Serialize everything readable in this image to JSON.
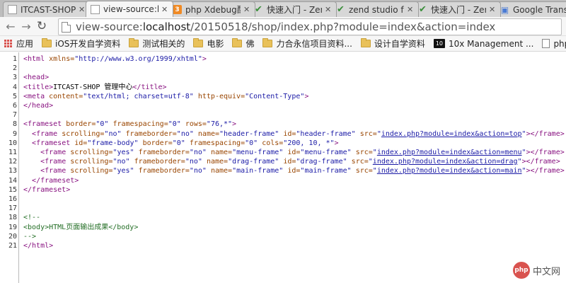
{
  "tabs": [
    {
      "title": "ITCAST-SHOP",
      "icon": "page-icon",
      "active": false
    },
    {
      "title": "view-source:l",
      "icon": "page-icon",
      "active": true
    },
    {
      "title": "php Xdebug配",
      "icon": "php-icon",
      "active": false
    },
    {
      "title": "快速入门 - Zen",
      "icon": "check-icon",
      "active": false
    },
    {
      "title": "zend studio fo",
      "icon": "check-icon",
      "active": false
    },
    {
      "title": "快速入门 - Zen",
      "icon": "check-icon",
      "active": false
    },
    {
      "title": "Google Trans",
      "icon": "google-icon",
      "active": false
    }
  ],
  "toolbar": {
    "url_scheme": "view-source:",
    "url_host": "localhost",
    "url_rest": "/20150518/shop/index.php?module=index&action=index"
  },
  "bookmarks": [
    {
      "label": "应用",
      "icon": "apps-icon"
    },
    {
      "label": "iOS开发自学资料",
      "icon": "folder-icon"
    },
    {
      "label": "测试相关的",
      "icon": "folder-icon"
    },
    {
      "label": "电影",
      "icon": "folder-icon"
    },
    {
      "label": "佛",
      "icon": "folder-icon"
    },
    {
      "label": "力合永信项目资料...",
      "icon": "folder-icon"
    },
    {
      "label": "设计自学资料",
      "icon": "folder-icon"
    },
    {
      "label": "10x Management ...",
      "icon": "tenx-icon"
    },
    {
      "label": "php外包服务商蓝",
      "icon": "page-icon"
    }
  ],
  "source_lines": [
    {
      "n": "1",
      "parts": [
        [
          "tag",
          "<html "
        ],
        [
          "attr",
          "xmlns="
        ],
        [
          "val",
          "\"http://www.w3.org/1999/xhtml\""
        ],
        [
          "tag",
          ">"
        ]
      ]
    },
    {
      "n": "2",
      "parts": []
    },
    {
      "n": "3",
      "parts": [
        [
          "tag",
          "<head>"
        ]
      ]
    },
    {
      "n": "4",
      "parts": [
        [
          "tag",
          "<title>"
        ],
        [
          "txt",
          "ITCAST-SHOP 管理中心"
        ],
        [
          "tag",
          "</title>"
        ]
      ]
    },
    {
      "n": "5",
      "parts": [
        [
          "tag",
          "<meta "
        ],
        [
          "attr",
          "content="
        ],
        [
          "val",
          "\"text/html; charset=utf-8\""
        ],
        [
          "attr",
          " http-equiv="
        ],
        [
          "val",
          "\"Content-Type\""
        ],
        [
          "tag",
          ">"
        ]
      ]
    },
    {
      "n": "6",
      "parts": [
        [
          "tag",
          "</head>"
        ]
      ]
    },
    {
      "n": "7",
      "parts": []
    },
    {
      "n": "8",
      "parts": [
        [
          "tag",
          "<frameset "
        ],
        [
          "attr",
          "border="
        ],
        [
          "val",
          "\"0\""
        ],
        [
          "attr",
          " framespacing="
        ],
        [
          "val",
          "\"0\""
        ],
        [
          "attr",
          " rows="
        ],
        [
          "val",
          "\"76,*\""
        ],
        [
          "tag",
          ">"
        ]
      ]
    },
    {
      "n": "9",
      "parts": [
        [
          "txt",
          "  "
        ],
        [
          "tag",
          "<frame "
        ],
        [
          "attr",
          "scrolling="
        ],
        [
          "val",
          "\"no\""
        ],
        [
          "attr",
          " frameborder="
        ],
        [
          "val",
          "\"no\""
        ],
        [
          "attr",
          " name="
        ],
        [
          "val",
          "\"header-frame\""
        ],
        [
          "attr",
          " id="
        ],
        [
          "val",
          "\"header-frame\""
        ],
        [
          "attr",
          " src="
        ],
        [
          "val",
          "\""
        ],
        [
          "lnk",
          "index.php?module=index&action=top"
        ],
        [
          "val",
          "\""
        ],
        [
          "tag",
          "></frame>"
        ]
      ]
    },
    {
      "n": "10",
      "parts": [
        [
          "txt",
          "  "
        ],
        [
          "tag",
          "<frameset "
        ],
        [
          "attr",
          "id="
        ],
        [
          "val",
          "\"frame-body\""
        ],
        [
          "attr",
          " border="
        ],
        [
          "val",
          "\"0\""
        ],
        [
          "attr",
          " framespacing="
        ],
        [
          "val",
          "\"0\""
        ],
        [
          "attr",
          " cols="
        ],
        [
          "val",
          "\"200, 10, *\""
        ],
        [
          "tag",
          ">"
        ]
      ]
    },
    {
      "n": "11",
      "parts": [
        [
          "txt",
          "    "
        ],
        [
          "tag",
          "<frame "
        ],
        [
          "attr",
          "scrolling="
        ],
        [
          "val",
          "\"yes\""
        ],
        [
          "attr",
          " frameborder="
        ],
        [
          "val",
          "\"no\""
        ],
        [
          "attr",
          " name="
        ],
        [
          "val",
          "\"menu-frame\""
        ],
        [
          "attr",
          " id="
        ],
        [
          "val",
          "\"menu-frame\""
        ],
        [
          "attr",
          " src="
        ],
        [
          "val",
          "\""
        ],
        [
          "lnk",
          "index.php?module=index&action=menu"
        ],
        [
          "val",
          "\""
        ],
        [
          "tag",
          "></frame>"
        ]
      ]
    },
    {
      "n": "12",
      "parts": [
        [
          "txt",
          "    "
        ],
        [
          "tag",
          "<frame "
        ],
        [
          "attr",
          "scrolling="
        ],
        [
          "val",
          "\"no\""
        ],
        [
          "attr",
          " frameborder="
        ],
        [
          "val",
          "\"no\""
        ],
        [
          "attr",
          " name="
        ],
        [
          "val",
          "\"drag-frame\""
        ],
        [
          "attr",
          " id="
        ],
        [
          "val",
          "\"drag-frame\""
        ],
        [
          "attr",
          " src="
        ],
        [
          "val",
          "\""
        ],
        [
          "lnk",
          "index.php?module=index&action=drag"
        ],
        [
          "val",
          "\""
        ],
        [
          "tag",
          "></frame>"
        ]
      ]
    },
    {
      "n": "13",
      "parts": [
        [
          "txt",
          "    "
        ],
        [
          "tag",
          "<frame "
        ],
        [
          "attr",
          "scrolling="
        ],
        [
          "val",
          "\"yes\""
        ],
        [
          "attr",
          " frameborder="
        ],
        [
          "val",
          "\"no\""
        ],
        [
          "attr",
          " name="
        ],
        [
          "val",
          "\"main-frame\""
        ],
        [
          "attr",
          " id="
        ],
        [
          "val",
          "\"main-frame\""
        ],
        [
          "attr",
          " src="
        ],
        [
          "val",
          "\""
        ],
        [
          "lnk",
          "index.php?module=index&action=main"
        ],
        [
          "val",
          "\""
        ],
        [
          "tag",
          "></frame>"
        ]
      ]
    },
    {
      "n": "14",
      "parts": [
        [
          "txt",
          "  "
        ],
        [
          "tag",
          "</frameset>"
        ]
      ]
    },
    {
      "n": "15",
      "parts": [
        [
          "tag",
          "</frameset>"
        ]
      ]
    },
    {
      "n": "16",
      "parts": []
    },
    {
      "n": "17",
      "parts": []
    },
    {
      "n": "18",
      "parts": [
        [
          "cmt",
          "<!--"
        ]
      ]
    },
    {
      "n": "19",
      "parts": [
        [
          "cmt",
          "<body>HTML页面输出成果</body>"
        ]
      ]
    },
    {
      "n": "20",
      "parts": [
        [
          "cmt",
          "-->"
        ]
      ]
    },
    {
      "n": "21",
      "parts": [
        [
          "tag",
          "</html>"
        ]
      ]
    }
  ],
  "watermark": {
    "badge": "php",
    "text": "中文网"
  }
}
